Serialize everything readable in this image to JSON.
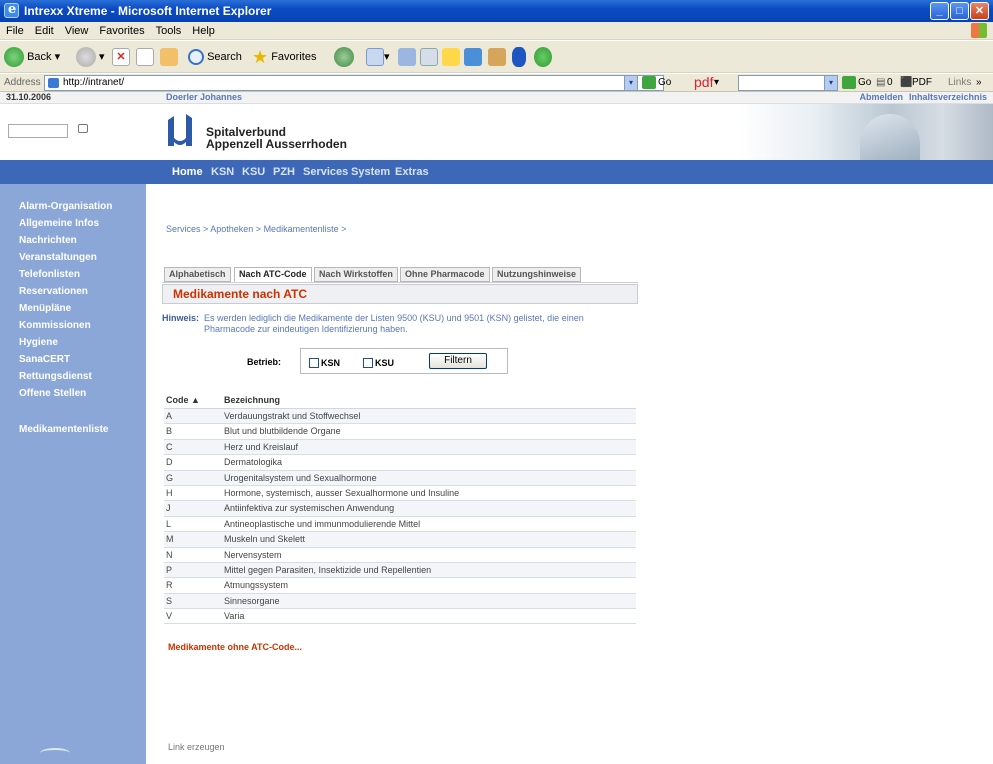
{
  "window": {
    "title": "Intrexx Xtreme - Microsoft Internet Explorer"
  },
  "menu": [
    "File",
    "Edit",
    "View",
    "Favorites",
    "Tools",
    "Help"
  ],
  "toolbar": {
    "back": "Back",
    "search": "Search",
    "favorites": "Favorites"
  },
  "address": {
    "label": "Address",
    "url": "http://intranet/",
    "go": "Go",
    "pdf_logo": "pdf",
    "go2": "Go",
    "count": "0",
    "pdf": "PDF",
    "links": "Links"
  },
  "top_strip": {
    "date": "31.10.2006",
    "user": "Doerler Johannes",
    "logout": "Abmelden",
    "index": "Inhaltsverzeichnis"
  },
  "logo": {
    "line1": "Spitalverbund",
    "line2": "Appenzell Ausserrhoden"
  },
  "nav": [
    "Home",
    "KSN",
    "KSU",
    "PZH",
    "Services",
    "System",
    "Extras"
  ],
  "sidebar": {
    "items": [
      "Alarm-Organisation",
      "Allgemeine Infos",
      "Nachrichten",
      "Veranstaltungen",
      "Telefonlisten",
      "Reservationen",
      "Menüpläne",
      "Kommissionen",
      "Hygiene",
      "SanaCERT",
      "Rettungsdienst",
      "Offene Stellen"
    ],
    "current": "Medikamentenliste"
  },
  "breadcrumb": "Services > Apotheken > Medikamentenliste >",
  "tabs": [
    "Alphabetisch",
    "Nach ATC-Code",
    "Nach Wirkstoffen",
    "Ohne Pharmacode",
    "Nutzungshinweise"
  ],
  "section_title": "Medikamente nach ATC",
  "hint": {
    "label": "Hinweis:",
    "text": "Es werden lediglich die Medikamente der Listen 9500 (KSU) und 9501 (KSN) gelistet, die einen Pharmacode zur eindeutigen Identifizierung haben."
  },
  "filter": {
    "label": "Betrieb:",
    "opt1": "KSN",
    "opt2": "KSU",
    "button": "Filtern"
  },
  "table": {
    "col_code": "Code",
    "col_name": "Bezeichnung",
    "rows": [
      [
        "A",
        "Verdauungstrakt und Stoffwechsel"
      ],
      [
        "B",
        "Blut und blutbildende Organe"
      ],
      [
        "C",
        "Herz und Kreislauf"
      ],
      [
        "D",
        "Dermatologika"
      ],
      [
        "G",
        "Urogenitalsystem und Sexualhormone"
      ],
      [
        "H",
        "Hormone, systemisch, ausser Sexualhormone und Insuline"
      ],
      [
        "J",
        "Antiinfektiva zur systemischen Anwendung"
      ],
      [
        "L",
        "Antineoplastische und immunmodulierende Mittel"
      ],
      [
        "M",
        "Muskeln und Skelett"
      ],
      [
        "N",
        "Nervensystem"
      ],
      [
        "P",
        "Mittel gegen Parasiten, Insektizide und Repellentien"
      ],
      [
        "R",
        "Atmungssystem"
      ],
      [
        "S",
        "Sinnesorgane"
      ],
      [
        "V",
        "Varia"
      ]
    ]
  },
  "ohne_link": "Medikamente ohne ATC-Code...",
  "footer_link": "Link erzeugen"
}
